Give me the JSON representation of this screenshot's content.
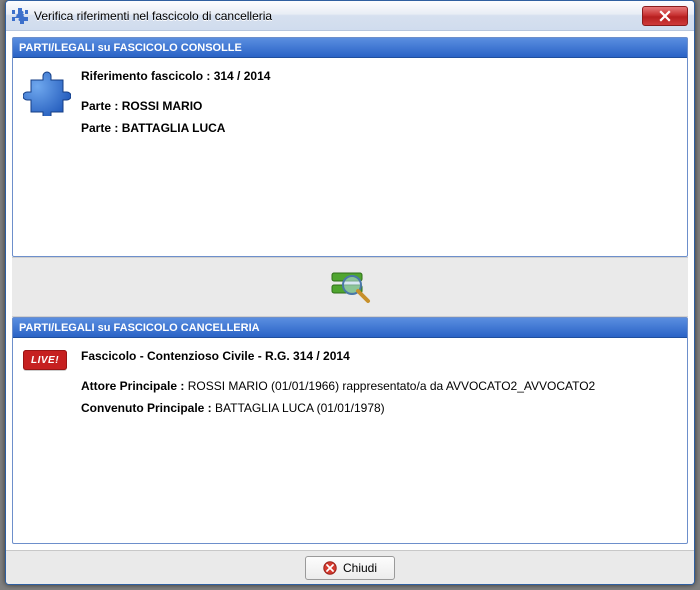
{
  "window": {
    "title": "Verifica riferimenti nel fascicolo di cancelleria"
  },
  "panel_top": {
    "header": "PARTI/LEGALI su FASCICOLO CONSOLLE",
    "riferimento_label": "Riferimento fascicolo :",
    "riferimento_value": "314 / 2014",
    "parte1_label": "Parte :",
    "parte1_value": "ROSSI MARIO",
    "parte2_label": "Parte :",
    "parte2_value": "BATTAGLIA LUCA"
  },
  "panel_bottom": {
    "header": "PARTI/LEGALI su FASCICOLO CANCELLERIA",
    "live_badge": "LIVE!",
    "fascicolo_label": "Fascicolo - Contenzioso Civile - R.G. 314 / 2014",
    "attore_label": "Attore Principale :",
    "attore_value": "ROSSI MARIO (01/01/1966) rappresentato/a da AVVOCATO2_AVVOCATO2",
    "convenuto_label": "Convenuto Principale :",
    "convenuto_value": "BATTAGLIA LUCA (01/01/1978)"
  },
  "footer": {
    "close_label": "Chiudi"
  }
}
